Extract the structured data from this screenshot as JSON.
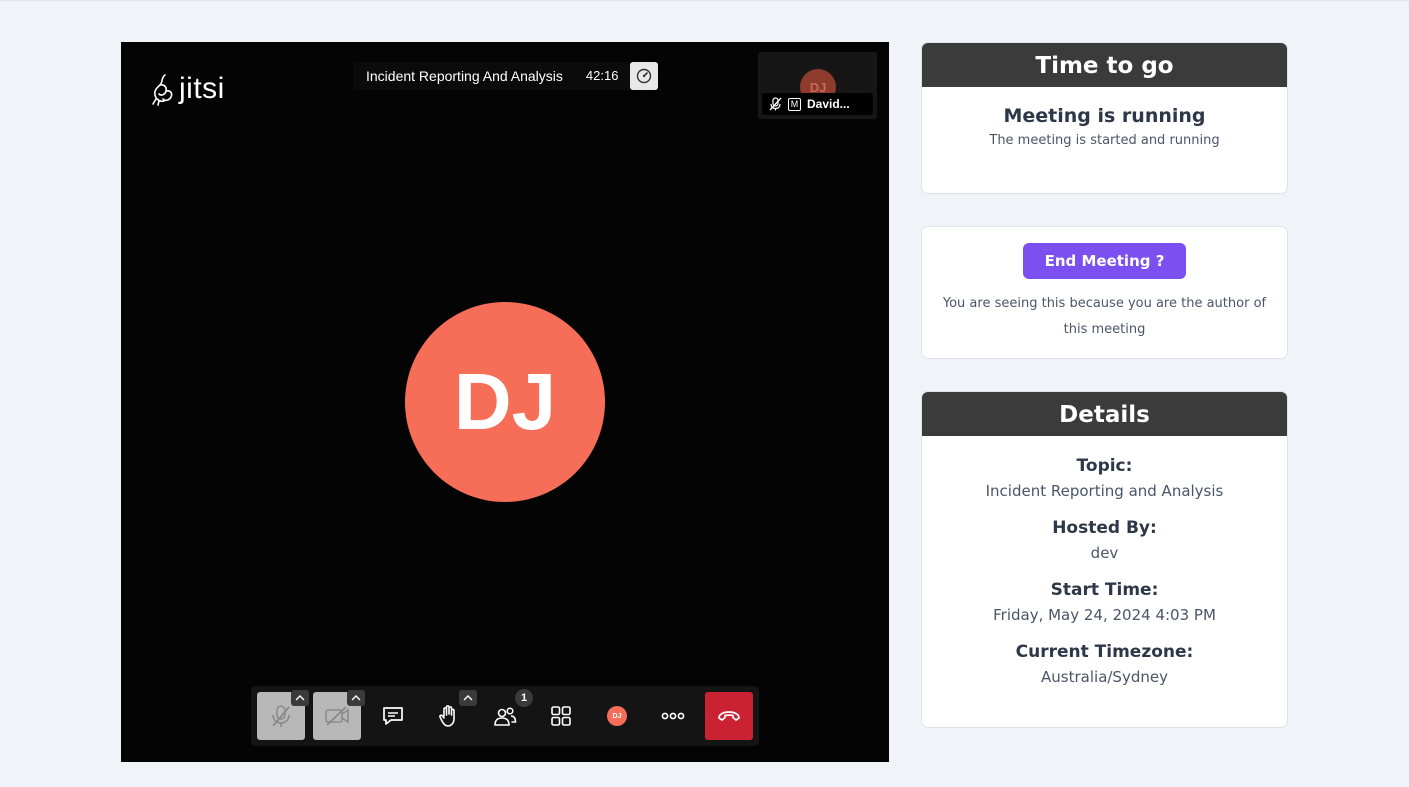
{
  "video": {
    "logo_text": "jitsi",
    "meeting_title": "Incident Reporting And Analysis",
    "timer": "42:16",
    "thumbnail": {
      "initials": "DJ",
      "name": "David...",
      "moderator_badge": "M"
    },
    "main_avatar_initials": "DJ",
    "toolbar": {
      "participant_count": "1",
      "avatar_initials": "DJ",
      "buttons": [
        "microphone-muted",
        "camera-off",
        "chat",
        "raise-hand",
        "participants",
        "tile-view",
        "profile",
        "more-actions",
        "hang-up"
      ]
    }
  },
  "status_card": {
    "header": "Time to go",
    "title": "Meeting is running",
    "subtitle": "The meeting is started and running"
  },
  "author_card": {
    "button_label": "End Meeting ?",
    "note": "You are seeing this because you are the author of this meeting"
  },
  "details_card": {
    "header": "Details",
    "topic_label": "Topic:",
    "topic_value": "Incident Reporting and Analysis",
    "host_label": "Hosted By:",
    "host_value": "dev",
    "start_label": "Start Time:",
    "start_value": "Friday, May 24, 2024 4:03 PM",
    "tz_label": "Current Timezone:",
    "tz_value": "Australia/Sydney"
  },
  "colors": {
    "page_bg": "#f0f4f8",
    "video_bg": "#040404",
    "avatar": "#f76e58",
    "card_header": "#3b3b3b",
    "end_button": "#7b4ff0",
    "hangup": "#cb2233"
  }
}
